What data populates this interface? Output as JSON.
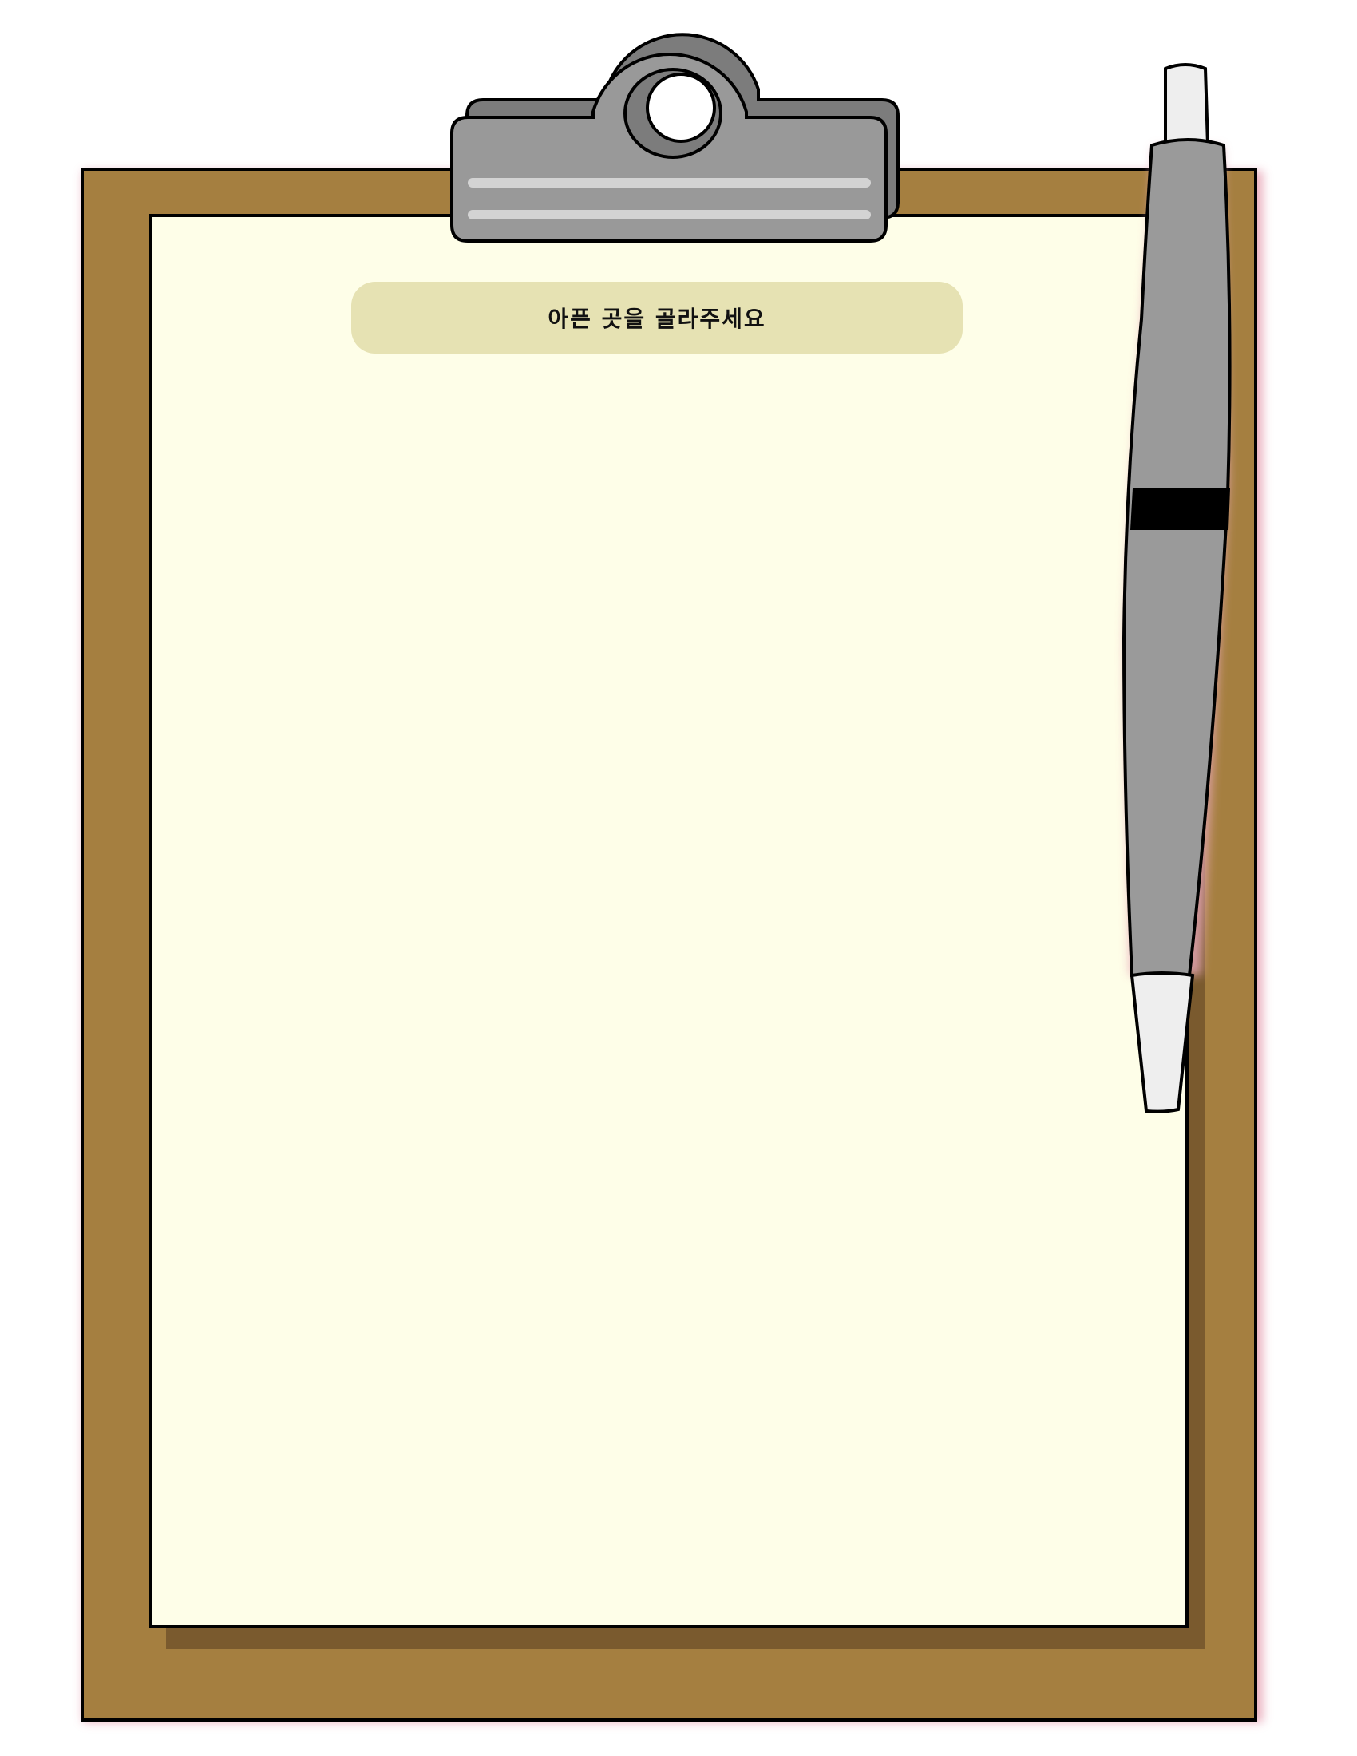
{
  "instruction": {
    "text": "아픈 곳을 골라주세요"
  },
  "colors": {
    "board": "#a57f40",
    "board_shadow": "#7a5a2e",
    "paper": "#fefee8",
    "pill": "#e6e2b3",
    "clip": "#999999",
    "clip_highlight": "#d3d3d3",
    "pen_body": "#9a9a9a",
    "pen_cap": "#eeeeee",
    "pen_band": "#000000",
    "glow": "#e8a7b8",
    "outline": "#000000"
  },
  "icons": {
    "clip": "clipboard-clip-icon",
    "pen": "ballpoint-pen-icon"
  }
}
